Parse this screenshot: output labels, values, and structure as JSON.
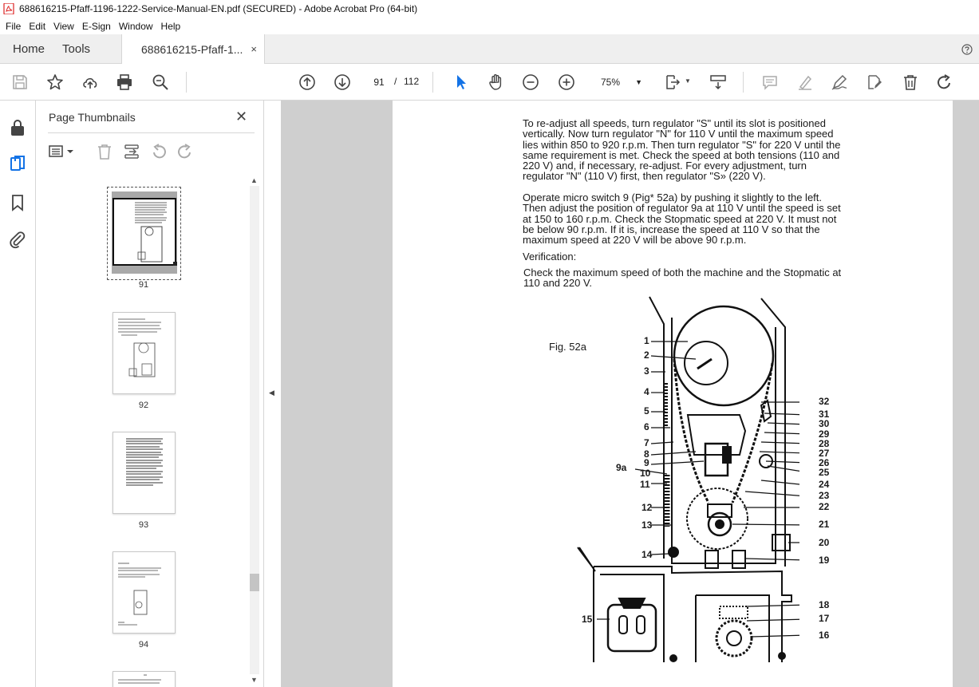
{
  "window": {
    "title": "688616215-Pfaff-1196-1222-Service-Manual-EN.pdf (SECURED) - Adobe Acrobat Pro (64-bit)"
  },
  "menu": [
    "File",
    "Edit",
    "View",
    "E-Sign",
    "Window",
    "Help"
  ],
  "tabs": {
    "home": "Home",
    "tools": "Tools",
    "document": "688616215-Pfaff-1...",
    "close": "×"
  },
  "toolbar": {
    "current_page": "91",
    "page_separator": "/",
    "total_pages": "112",
    "zoom": "75%"
  },
  "thumbnails_panel": {
    "title": "Page Thumbnails",
    "close": "✕",
    "pages": [
      "91",
      "92",
      "93",
      "94"
    ]
  },
  "document": {
    "paragraph1": [
      "To re-adjust all speeds, turn regulator \"S\" until its slot is positioned",
      "vertically. Now turn regulator \"N\" for 110 V until the maximum speed",
      "lies within 850 to 920 r.p.m. Then turn regulator \"S\" for 220 V until the",
      "same requirement is met. Check the speed at both tensions (110 and",
      "220 V) and, if necessary, re-adjust. For every adjustment, turn",
      "regulator \"N\" (110 V) first, then regulator \"S» (220 V)."
    ],
    "paragraph2": [
      "Operate micro switch 9   (Pig* 52a) by pushing it slightly to the left.",
      "Then adjust the position of regulator 9a at 110 V until the speed is set",
      "at 150 to 160 r.p.m. Check the Stopmatic speed at 220 V. It must not",
      "be below 90 r.p.m. If it is, increase the speed at 110 V so that the",
      "maximum speed at 220 V will be above 90 r.p.m."
    ],
    "verification_heading": "Verification:",
    "paragraph3": [
      "Check the maximum speed of both the machine and the Stopmatic at",
      "110 and 220 V."
    ],
    "figure_label": "Fig. 52a",
    "callouts_left": [
      "1",
      "2",
      "3",
      "4",
      "5",
      "6",
      "7",
      "8",
      "9",
      "9a",
      "10",
      "11",
      "12",
      "13",
      "14",
      "15"
    ],
    "callouts_right": [
      "32",
      "31",
      "30",
      "29",
      "28",
      "27",
      "26",
      "25",
      "24",
      "23",
      "22",
      "21",
      "20",
      "19",
      "18",
      "17",
      "16"
    ]
  }
}
